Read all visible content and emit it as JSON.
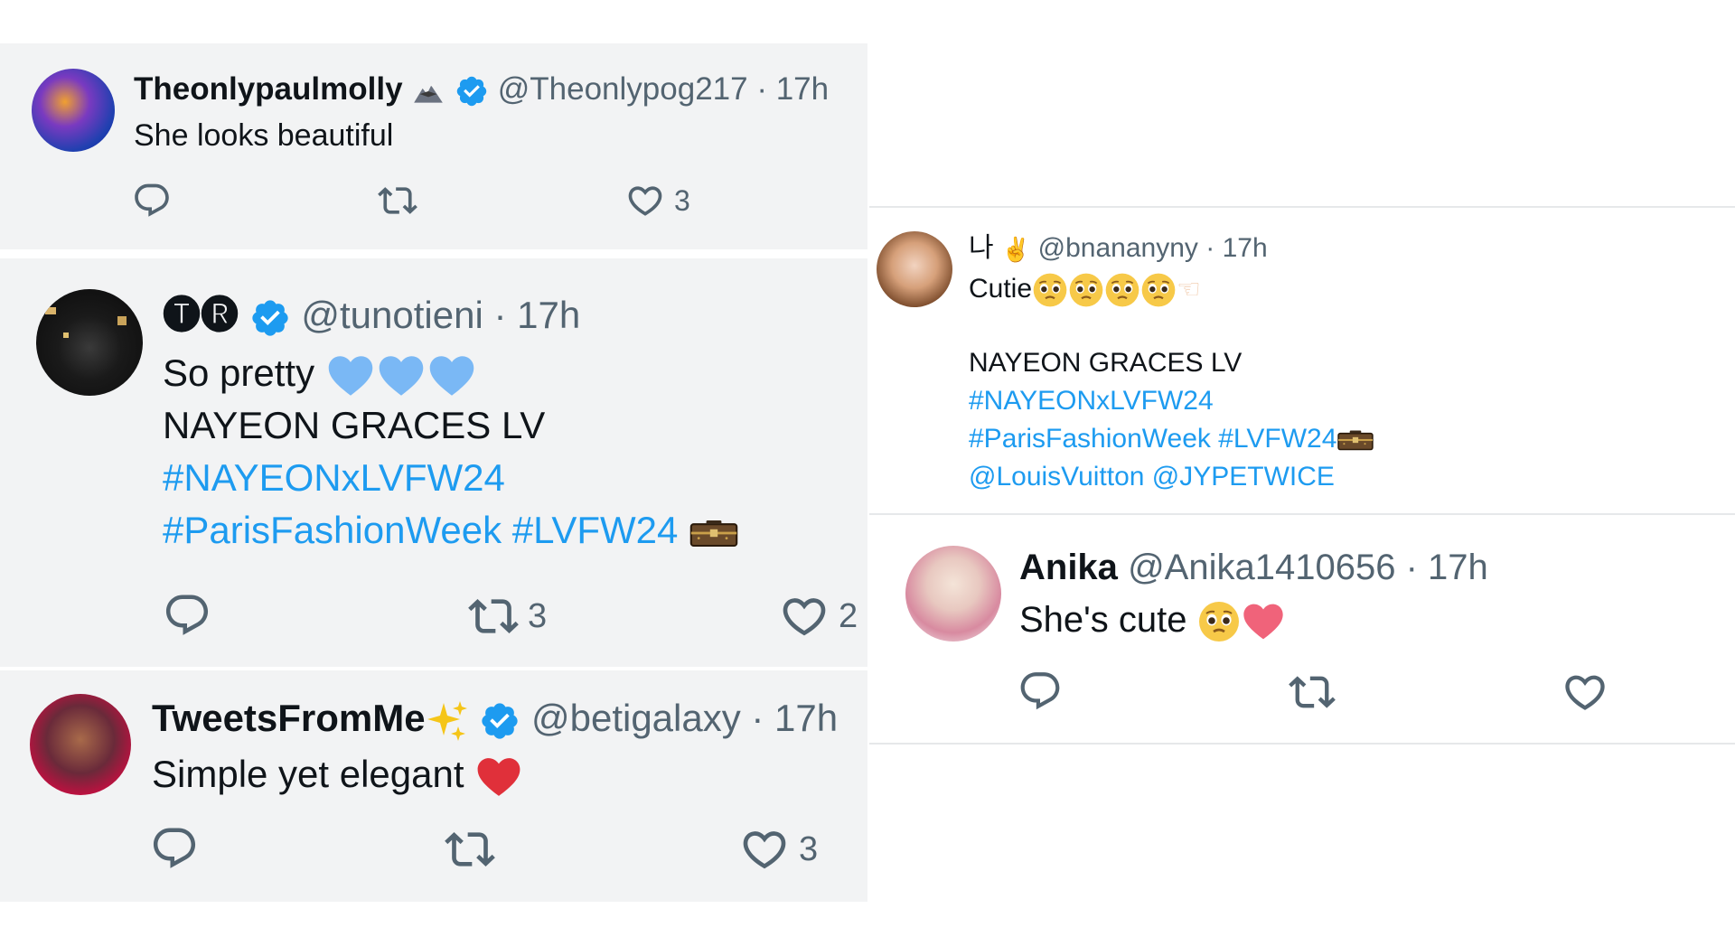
{
  "tweets": [
    {
      "display_name": "Theonlypaulmolly",
      "name_emoji": "eagle-emoji",
      "verified": true,
      "handle": "@Theonlypog217",
      "time": "· 17h",
      "lines": [
        "She looks beautiful"
      ],
      "actions": {
        "reply": "",
        "retweet": "",
        "like": "3"
      }
    },
    {
      "display_name": "🅣🅡",
      "verified": true,
      "handle": "@tunotieni",
      "time": "· 17h",
      "lines": [
        "So pretty",
        "NAYEON GRACES LV",
        "#NAYEONxLVFW24",
        "#ParisFashionWeek #LVFW24"
      ],
      "line_emojis": [
        "blue-heart-emoji",
        "blue-heart-emoji",
        "blue-heart-emoji",
        "trunk-emoji"
      ],
      "actions": {
        "reply": "",
        "retweet": "3",
        "like": "2"
      }
    },
    {
      "display_name": "TweetsFromMe",
      "name_emoji": "sparkles-emoji",
      "verified": true,
      "handle": "@betigalaxy",
      "time": "· 17h",
      "lines": [
        "Simple yet elegant"
      ],
      "line_emojis": [
        "red-heart-emoji"
      ],
      "actions": {
        "reply": "",
        "retweet": "",
        "like": "3"
      }
    },
    {
      "display_name": "나",
      "name_emoji": "fingers-crossed-emoji",
      "verified": false,
      "handle": "@bnananyny",
      "time": "· 17h",
      "lines": [
        "Cutie",
        "NAYEON GRACES LV",
        "#NAYEONxLVFW24",
        "#ParisFashionWeek #LVFW24",
        "@LouisVuitton @JYPETWICE"
      ],
      "line_emojis": [
        "pleading-face-emoji",
        "pointing-hand-emoji",
        "trunk-emoji"
      ]
    },
    {
      "display_name": "Anika",
      "verified": false,
      "handle": "@Anika1410656",
      "time": "· 17h",
      "lines": [
        "She's cute"
      ],
      "line_emojis": [
        "pleading-face-emoji",
        "pink-heart-emoji"
      ],
      "actions": {
        "reply": "",
        "retweet": "",
        "like": ""
      }
    }
  ],
  "colors": {
    "link": "#1d9bf0",
    "verified": "#1d9bf0",
    "muted": "#536471",
    "panel_bg": "#f2f3f4"
  }
}
